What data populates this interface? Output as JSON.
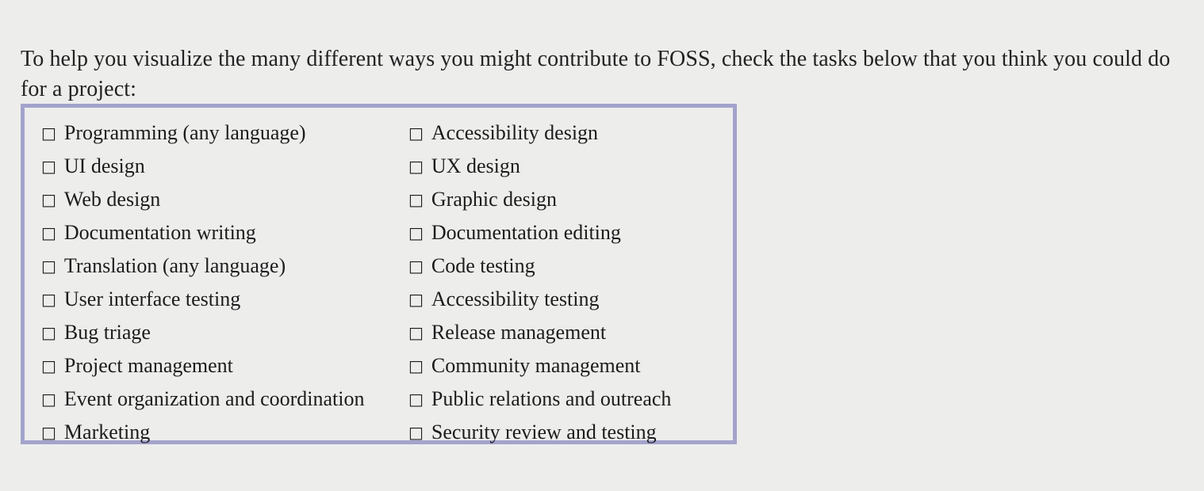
{
  "colors": {
    "background": "#ededec",
    "text": "#1c1c1c",
    "intro_text": "#222222",
    "box_border": "#a3a3cc"
  },
  "intro": {
    "paragraph": "To help you visualize the many different ways you might contribute to FOSS, check the tasks below that you think you could do for a project:"
  },
  "task_box": {
    "checkbox_glyph": "□",
    "checkbox_icon_name": "empty-checkbox-icon",
    "rows": [
      {
        "left": "Programming (any language)",
        "right": "Accessibility design"
      },
      {
        "left": "UI design",
        "right": "UX design"
      },
      {
        "left": "Web design",
        "right": "Graphic design"
      },
      {
        "left": "Documentation writing",
        "right": "Documentation editing"
      },
      {
        "left": "Translation (any language)",
        "right": "Code testing"
      },
      {
        "left": "User interface testing",
        "right": "Accessibility testing"
      },
      {
        "left": "Bug triage",
        "right": "Release management"
      },
      {
        "left": "Project management",
        "right": "Community management"
      },
      {
        "left": "Event organization and coordination",
        "right": "Public relations and outreach"
      },
      {
        "left": "Marketing",
        "right": "Security review and testing"
      }
    ]
  }
}
